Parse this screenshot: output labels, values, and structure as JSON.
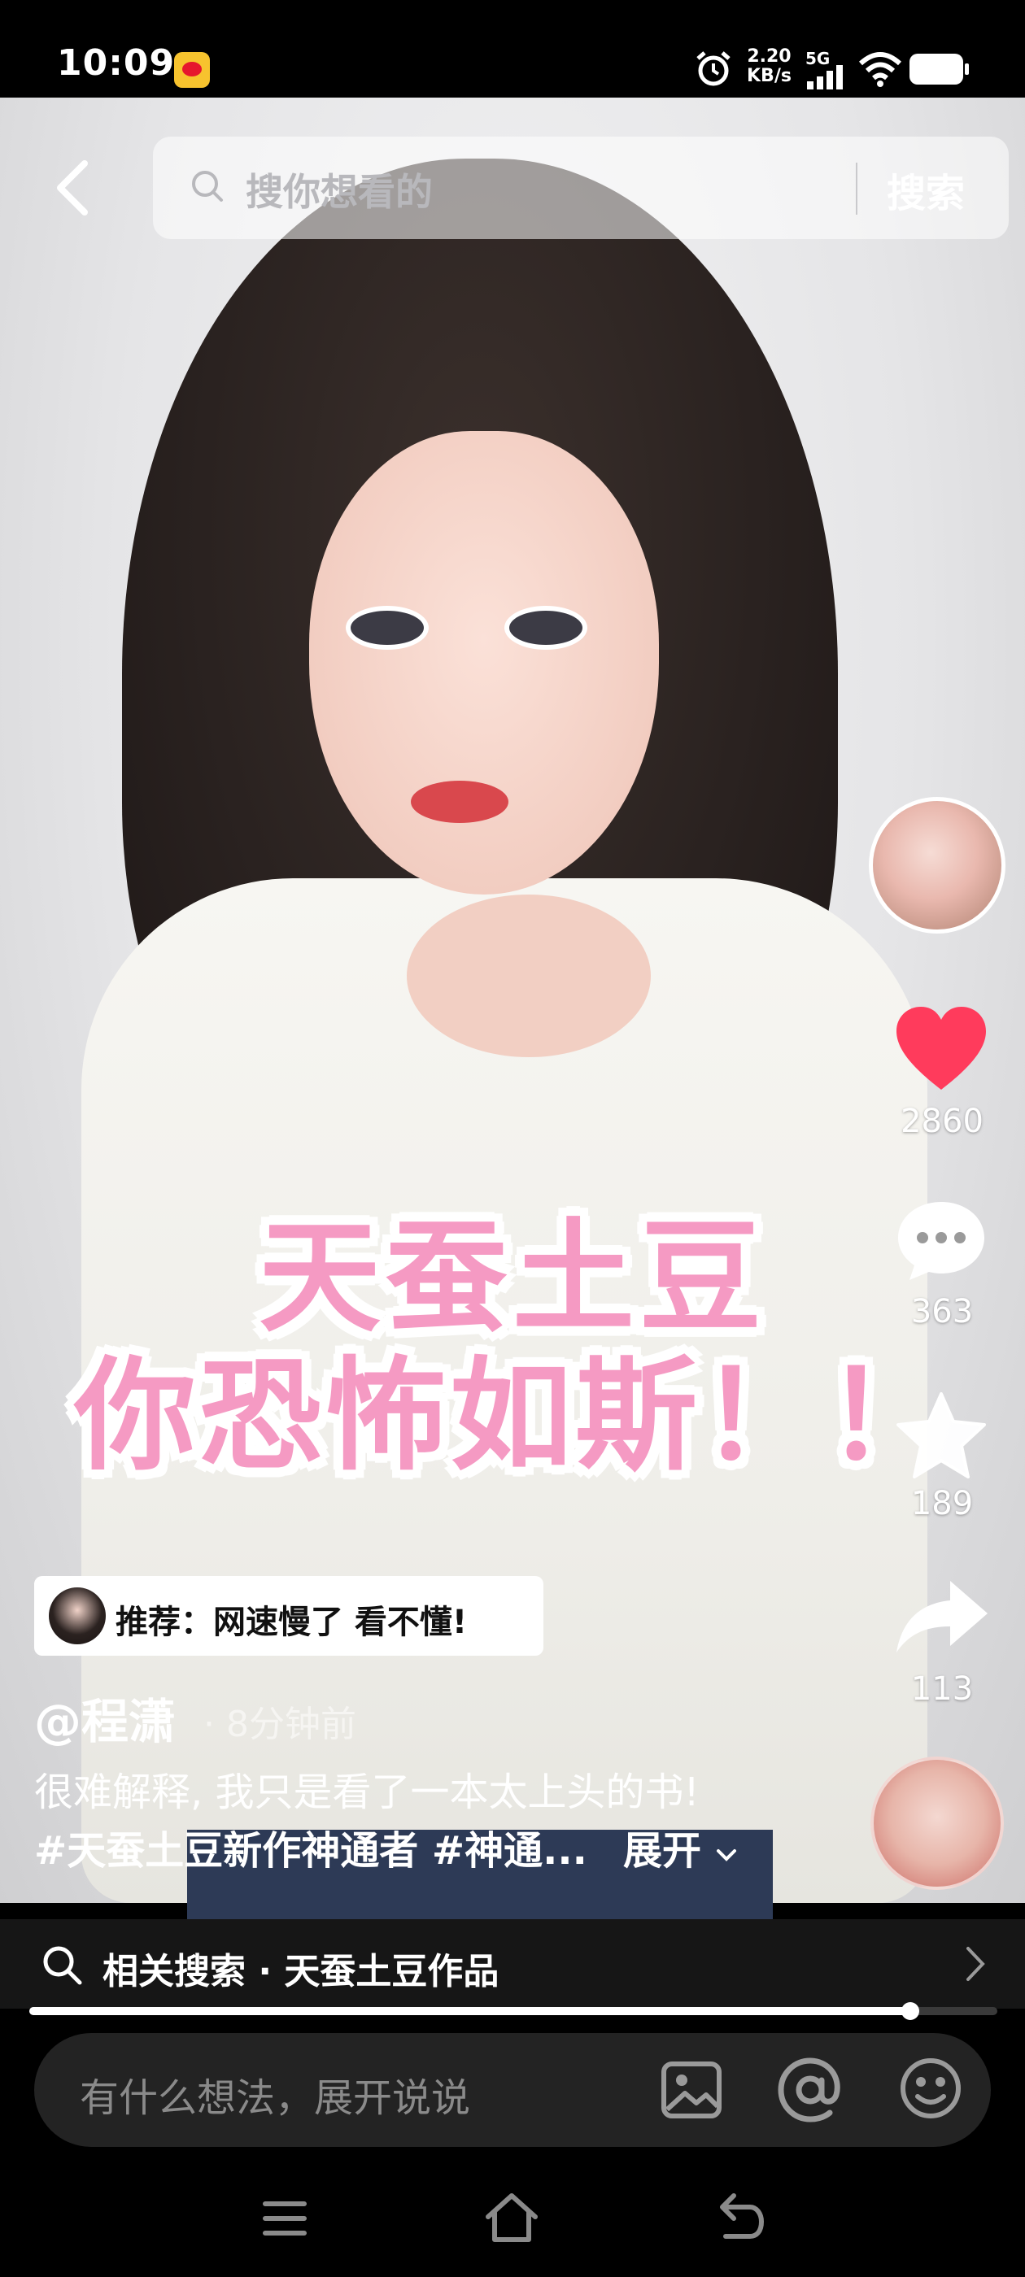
{
  "status_bar": {
    "time": "10:09",
    "net_speed_value": "2.20",
    "net_speed_unit": "KB/s",
    "network": "5G"
  },
  "search": {
    "placeholder": "搜你想看的",
    "button_label": "搜索"
  },
  "caption": {
    "line1": "天蚕土豆",
    "line2": "你恐怖如斯！！"
  },
  "actions": {
    "likes": "2860",
    "comments": "363",
    "favorites": "189",
    "shares": "113",
    "like_color": "#ff3b5c"
  },
  "recommend": {
    "text": "推荐：网速慢了 看不懂!"
  },
  "post": {
    "author": "@程潇",
    "time_ago": "· 8分钟前",
    "desc_line1": "很难解释, 我只是看了一本太上头的书!",
    "desc_line2": "#天蚕土豆新作神通者 #神通...",
    "expand_label": "展开"
  },
  "related": {
    "text": "相关搜索 · 天蚕土豆作品"
  },
  "progress": {
    "fraction": 0.91
  },
  "comment_input": {
    "placeholder": "有什么想法，展开说说"
  },
  "icons": [
    "back-icon",
    "search-icon",
    "heart-icon",
    "comment-icon",
    "star-icon",
    "share-icon",
    "image-icon",
    "at-icon",
    "emoji-icon",
    "menu-icon",
    "home-icon",
    "return-icon"
  ]
}
